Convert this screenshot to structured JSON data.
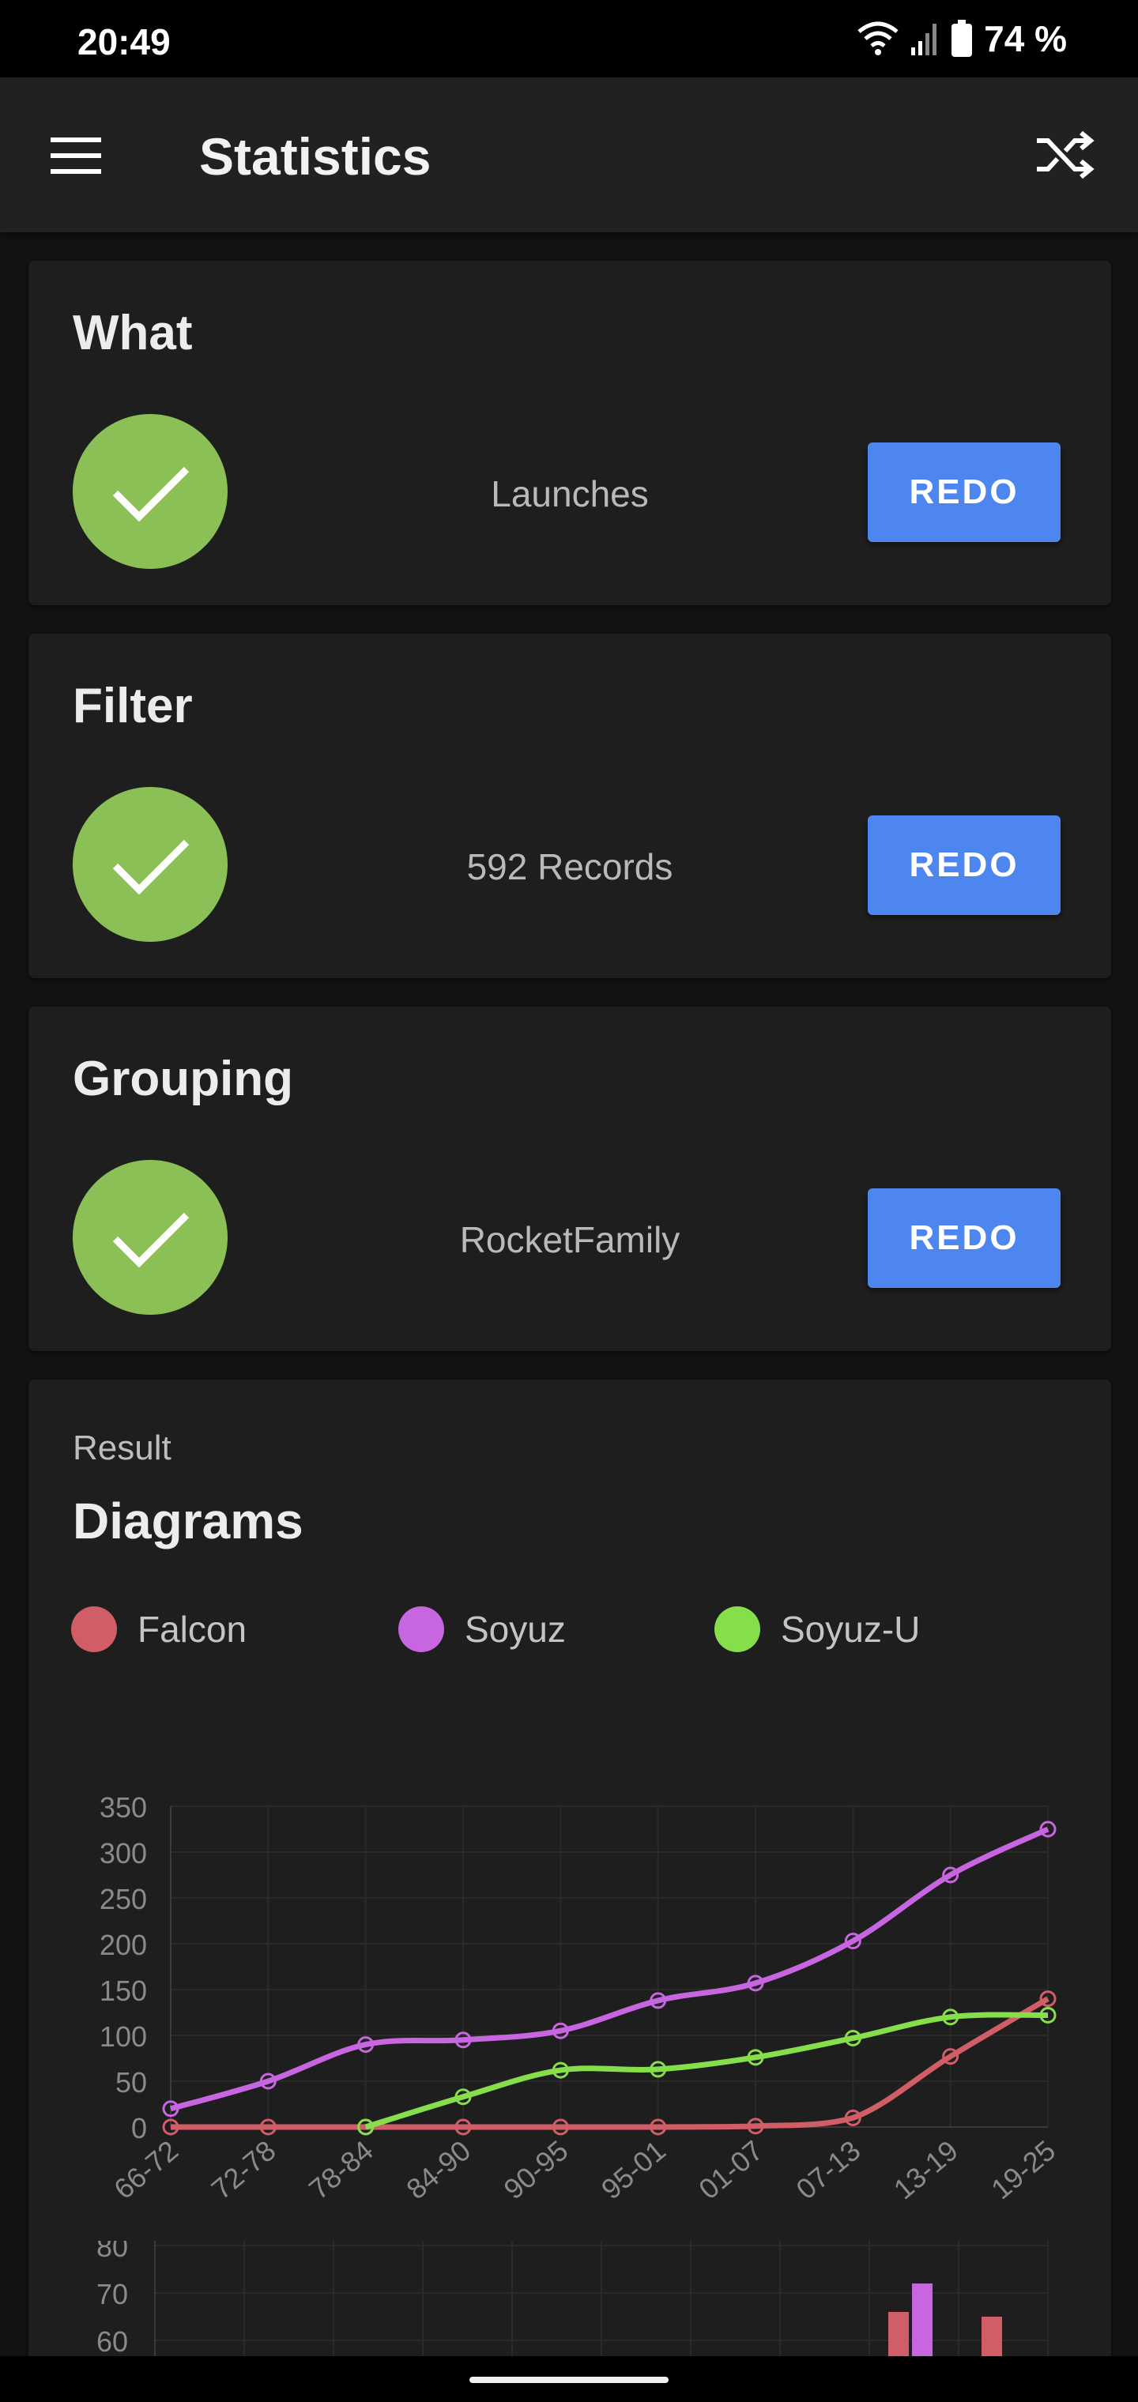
{
  "status_bar": {
    "time": "20:49",
    "battery": "74 %",
    "icons": [
      "wifi-icon",
      "signal-icon",
      "battery-icon"
    ]
  },
  "app_bar": {
    "title": "Statistics",
    "menu_icon": "menu-icon",
    "action_icon": "shuffle-icon"
  },
  "steps": [
    {
      "heading": "What",
      "value": "Launches",
      "button": "REDO"
    },
    {
      "heading": "Filter",
      "value": "592 Records",
      "button": "REDO"
    },
    {
      "heading": "Grouping",
      "value": "RocketFamily",
      "button": "REDO"
    }
  ],
  "result": {
    "label": "Result",
    "title": "Diagrams",
    "legend": [
      {
        "name": "Falcon",
        "color": "#d15d67"
      },
      {
        "name": "Soyuz",
        "color": "#c865e0"
      },
      {
        "name": "Soyuz-U",
        "color": "#86df4a"
      }
    ]
  },
  "chart_data": [
    {
      "type": "line",
      "x": [
        "66-72",
        "72-78",
        "78-84",
        "84-90",
        "90-95",
        "95-01",
        "01-07",
        "07-13",
        "13-19",
        "19-25"
      ],
      "ylim": [
        0,
        350
      ],
      "yticks": [
        "0",
        "50",
        "100",
        "150",
        "200",
        "250",
        "300",
        "350"
      ],
      "grid": true,
      "series": [
        {
          "name": "Falcon",
          "color": "#d15d67",
          "values": [
            0,
            0,
            0,
            0,
            0,
            0,
            1,
            10,
            77,
            140
          ]
        },
        {
          "name": "Soyuz",
          "color": "#c865e0",
          "values": [
            20,
            50,
            90,
            95,
            105,
            138,
            157,
            203,
            275,
            325
          ]
        },
        {
          "name": "Soyuz-U",
          "color": "#86df4a",
          "values": [
            null,
            null,
            0,
            33,
            62,
            63,
            76,
            97,
            120,
            122
          ]
        }
      ]
    },
    {
      "type": "bar",
      "yticks": [
        "60",
        "70",
        "80"
      ],
      "ylim": [
        60,
        80
      ],
      "grid": true,
      "visible_bars": [
        {
          "series": "Falcon",
          "color": "#d15d67",
          "value": 66
        },
        {
          "series": "Soyuz",
          "color": "#c865e0",
          "value": 72
        },
        {
          "series": "Falcon",
          "color": "#d15d67",
          "value": 65
        }
      ]
    }
  ]
}
